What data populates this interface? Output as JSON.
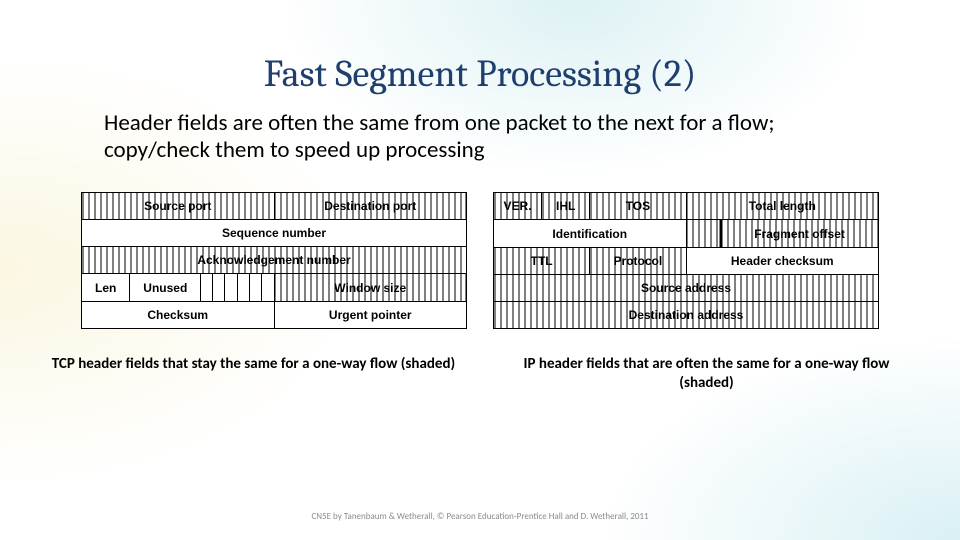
{
  "title": "Fast Segment Processing (2)",
  "body": "Header fields are often the same from one packet to the next for a flow; copy/check them to speed up processing",
  "tcp": {
    "source_port": "Source port",
    "dest_port": "Destination port",
    "seq": "Sequence number",
    "ack": "Acknowledgement number",
    "len": "Len",
    "unused": "Unused",
    "window": "Window size",
    "checksum": "Checksum",
    "urgent": "Urgent pointer"
  },
  "ip": {
    "ver": "VER.",
    "ihl": "IHL",
    "tos": "TOS",
    "total_len": "Total length",
    "identification": "Identification",
    "frag_off": "Fragment offset",
    "ttl": "TTL",
    "protocol": "Protocol",
    "hdr_chk": "Header checksum",
    "src_addr": "Source address",
    "dst_addr": "Destination address"
  },
  "caption_tcp": "TCP header fields that stay the same for a one-way flow (shaded)",
  "caption_ip": "IP header fields that are often the same for a one-way flow (shaded)",
  "credit": "CN5E by Tanenbaum & Wetherall, © Pearson Education-Prentice Hall and D. Wetherall, 2011"
}
